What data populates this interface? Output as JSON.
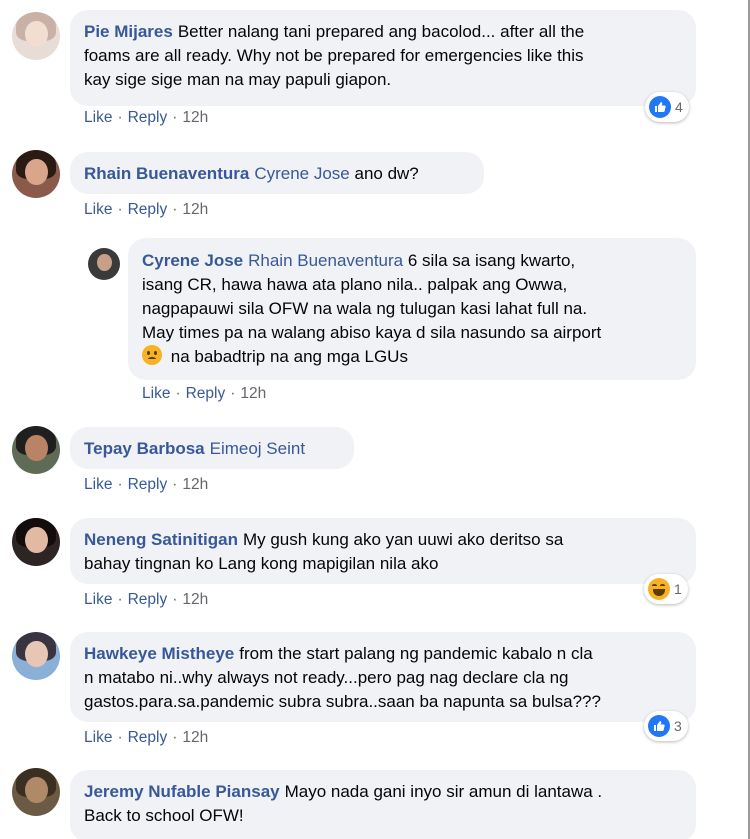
{
  "comments": [
    {
      "author": "Pie Mijares",
      "lines": [
        "Better nalang tani prepared ang bacolod... after all the",
        "foams are all ready. Why not be prepared for emergencies like this",
        "kay sige sige man na may papuli giapon."
      ],
      "actions": {
        "like": "Like",
        "reply": "Reply",
        "time": "12h"
      },
      "reaction": {
        "type": "like",
        "count": "4"
      }
    },
    {
      "author": "Rhain Buenaventura",
      "mention": "Cyrene Jose",
      "lines": [
        "ano dw?"
      ],
      "actions": {
        "like": "Like",
        "reply": "Reply",
        "time": "12h"
      }
    },
    {
      "author": "Cyrene Jose",
      "mention": "Rhain Buenaventura",
      "lines": [
        "6 sila sa isang kwarto,",
        "isang CR, hawa hawa ata plano nila.. palpak ang Owwa,",
        "nagpapauwi sila OFW na wala ng tulugan kasi lahat full na.",
        "May times pa na walang abiso kaya d sila nasundo sa airport",
        "na babadtrip na ang mga LGUs"
      ],
      "actions": {
        "like": "Like",
        "reply": "Reply",
        "time": "12h"
      }
    },
    {
      "author": "Tepay Barbosa",
      "mention": "Eimeoj Seint",
      "lines": [
        ""
      ],
      "actions": {
        "like": "Like",
        "reply": "Reply",
        "time": "12h"
      }
    },
    {
      "author": "Neneng Satinitigan",
      "lines": [
        "My gush kung ako yan uuwi ako deritso sa",
        "bahay tingnan ko Lang kong mapigilan nila ako"
      ],
      "actions": {
        "like": "Like",
        "reply": "Reply",
        "time": "12h"
      },
      "reaction": {
        "type": "haha",
        "count": "1"
      }
    },
    {
      "author": "Hawkeye Mistheye",
      "lines": [
        "from the start palang ng pandemic kabalo n cla",
        "n matabo ni..why always not ready...pero pag nag declare cla ng",
        "gastos.para.sa.pandemic subra subra..saan ba napunta sa bulsa???"
      ],
      "actions": {
        "like": "Like",
        "reply": "Reply",
        "time": "12h"
      },
      "reaction": {
        "type": "like",
        "count": "3"
      }
    },
    {
      "author": "Jeremy Nufable Piansay",
      "lines": [
        "Mayo nada gani inyo sir amun di lantawa .",
        "Back to school OFW!"
      ]
    }
  ],
  "colors": {
    "bubble": "#f0f2f5",
    "link": "#385898",
    "meta": "#65676b",
    "like_blue": "#2078f4",
    "haha_yellow": "#f7b125"
  },
  "icons": {
    "like": "thumbs-up-icon",
    "haha": "haha-emoji-icon",
    "sad": "sad-emoji-icon"
  }
}
